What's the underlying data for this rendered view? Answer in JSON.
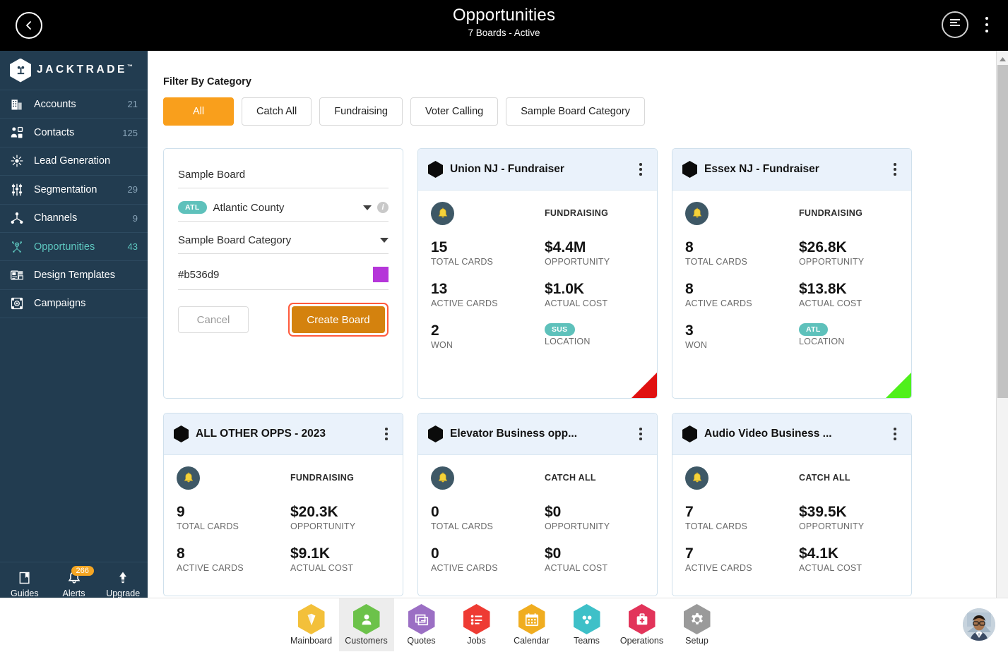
{
  "topbar": {
    "back_icon": "chevron-left-icon",
    "title": "Opportunities",
    "subtitle": "7 Boards - Active",
    "menu_icon": "list-menu-icon",
    "kebab_icon": "vertical-dots-icon"
  },
  "sidebar": {
    "brand": "JACKTRADE",
    "brand_tm": "™",
    "brand_mark": "jacktrade-hex-logo",
    "items": [
      {
        "label": "Accounts",
        "count": "21",
        "icon": "building-icon",
        "active": false
      },
      {
        "label": "Contacts",
        "count": "125",
        "icon": "contacts-icon",
        "active": false
      },
      {
        "label": "Lead Generation",
        "count": "",
        "icon": "lead-gen-icon",
        "active": false
      },
      {
        "label": "Segmentation",
        "count": "29",
        "icon": "segmentation-icon",
        "active": false
      },
      {
        "label": "Channels",
        "count": "9",
        "icon": "channels-icon",
        "active": false
      },
      {
        "label": "Opportunities",
        "count": "43",
        "icon": "opportunities-icon",
        "active": true
      },
      {
        "label": "Design Templates",
        "count": "",
        "icon": "design-template-icon",
        "active": false
      },
      {
        "label": "Campaigns",
        "count": "",
        "icon": "campaigns-icon",
        "active": false
      }
    ],
    "tools": [
      {
        "label": "Guides",
        "icon": "book-icon",
        "badge": ""
      },
      {
        "label": "Alerts",
        "icon": "bell-icon",
        "badge": "266"
      },
      {
        "label": "Upgrade",
        "icon": "arrow-up-icon",
        "badge": ""
      }
    ],
    "hex_shortcuts": [
      {
        "icon": "person-icon"
      },
      {
        "icon": "dollar-icon"
      },
      {
        "icon": "money-transfer-icon"
      },
      {
        "icon": "workflow-icon"
      }
    ],
    "accent_active": "#5ec8c0",
    "background": "#223c50"
  },
  "main": {
    "filter_label": "Filter By Category",
    "filters": [
      {
        "label": "All",
        "selected": true
      },
      {
        "label": "Catch All",
        "selected": false
      },
      {
        "label": "Fundraising",
        "selected": false
      },
      {
        "label": "Voter Calling",
        "selected": false
      },
      {
        "label": "Sample Board Category",
        "selected": false
      }
    ],
    "filter_selected_color": "#f99f1c"
  },
  "new_board_form": {
    "name_value": "Sample Board",
    "location_pill": "ATL",
    "location_value": "Atlantic County",
    "location_dropdown_icon": "chevron-down-icon",
    "location_info_icon": "info-icon",
    "category_value": "Sample Board Category",
    "category_dropdown_icon": "chevron-down-icon",
    "color_value": "#b536d9",
    "color_swatch": "#b536d9",
    "cancel_label": "Cancel",
    "create_label": "Create Board",
    "create_highlight_color": "#ff5a3c"
  },
  "stat_labels": {
    "total_cards": "TOTAL CARDS",
    "active_cards": "ACTIVE CARDS",
    "won": "WON",
    "opportunity": "OPPORTUNITY",
    "actual_cost": "ACTUAL COST",
    "location": "LOCATION"
  },
  "boards": [
    {
      "title": "Union NJ - Fundraiser",
      "category": "FUNDRAISING",
      "total_cards": "15",
      "active_cards": "13",
      "won": "2",
      "opportunity": "$4.4M",
      "actual_cost": "$1.0K",
      "location_pill": "SUS",
      "corner_color": "red",
      "bell_icon": "bell-icon",
      "kebab_icon": "vertical-dots-icon",
      "hex_icon": "board-hex-icon",
      "compact": false
    },
    {
      "title": "Essex NJ - Fundraiser",
      "category": "FUNDRAISING",
      "total_cards": "8",
      "active_cards": "8",
      "won": "3",
      "opportunity": "$26.8K",
      "actual_cost": "$13.8K",
      "location_pill": "ATL",
      "corner_color": "green",
      "bell_icon": "bell-icon",
      "kebab_icon": "vertical-dots-icon",
      "hex_icon": "board-hex-icon",
      "compact": false
    },
    {
      "title": "ALL OTHER OPPS - 2023",
      "category": "FUNDRAISING",
      "total_cards": "9",
      "active_cards": "8",
      "won": "",
      "opportunity": "$20.3K",
      "actual_cost": "$9.1K",
      "location_pill": "",
      "corner_color": "",
      "bell_icon": "bell-icon",
      "kebab_icon": "vertical-dots-icon",
      "hex_icon": "board-hex-icon",
      "compact": true
    },
    {
      "title": "Elevator Business opp...",
      "category": "CATCH ALL",
      "total_cards": "0",
      "active_cards": "0",
      "won": "",
      "opportunity": "$0",
      "actual_cost": "$0",
      "location_pill": "",
      "corner_color": "",
      "bell_icon": "bell-icon",
      "kebab_icon": "vertical-dots-icon",
      "hex_icon": "board-hex-icon",
      "compact": true
    },
    {
      "title": "Audio Video Business ...",
      "category": "CATCH ALL",
      "total_cards": "7",
      "active_cards": "7",
      "won": "",
      "opportunity": "$39.5K",
      "actual_cost": "$4.1K",
      "location_pill": "",
      "corner_color": "",
      "bell_icon": "bell-icon",
      "kebab_icon": "vertical-dots-icon",
      "hex_icon": "board-hex-icon",
      "compact": true
    }
  ],
  "bottom_nav": {
    "items": [
      {
        "label": "Mainboard",
        "icon": "mainboard-icon",
        "color": "#f3c03a",
        "active": false
      },
      {
        "label": "Customers",
        "icon": "customers-icon",
        "color": "#6cc24a",
        "active": true
      },
      {
        "label": "Quotes",
        "icon": "quotes-icon",
        "color": "#9b6fc4",
        "active": false
      },
      {
        "label": "Jobs",
        "icon": "jobs-icon",
        "color": "#ee3b33",
        "active": false
      },
      {
        "label": "Calendar",
        "icon": "calendar-icon",
        "color": "#f0ad20",
        "active": false
      },
      {
        "label": "Teams",
        "icon": "teams-icon",
        "color": "#3ec0c8",
        "active": false
      },
      {
        "label": "Operations",
        "icon": "operations-icon",
        "color": "#e2345a",
        "active": false
      },
      {
        "label": "Setup",
        "icon": "setup-icon",
        "color": "#9a9a9a",
        "active": false
      }
    ],
    "avatar": "user-avatar"
  }
}
